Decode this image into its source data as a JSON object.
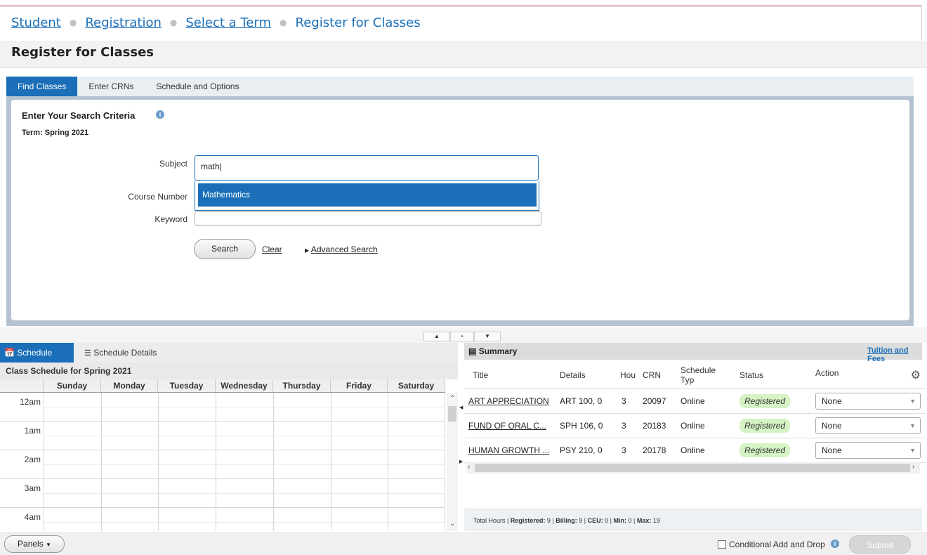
{
  "breadcrumb": {
    "items": [
      "Student",
      "Registration",
      "Select a Term"
    ],
    "current": "Register for Classes"
  },
  "page_title": "Register for Classes",
  "search_tabs": [
    "Find Classes",
    "Enter CRNs",
    "Schedule and Options"
  ],
  "search": {
    "title": "Enter Your Search Criteria",
    "term": "Term: Spring 2021",
    "subject_label": "Subject",
    "subject_value": "math",
    "subject_suggestion": "Mathematics",
    "course_number_label": "Course Number",
    "keyword_label": "Keyword",
    "search_button": "Search",
    "clear_link": "Clear",
    "advanced_link": "Advanced Search"
  },
  "schedule": {
    "tab_schedule": "Schedule",
    "tab_details": "Schedule Details",
    "caption": "Class Schedule for Spring 2021",
    "days": [
      "Sunday",
      "Monday",
      "Tuesday",
      "Wednesday",
      "Thursday",
      "Friday",
      "Saturday"
    ],
    "hours": [
      "12am",
      "1am",
      "2am",
      "3am",
      "4am"
    ]
  },
  "summary": {
    "title": "Summary",
    "tuition_link": "Tuition and Fees",
    "columns": [
      "Title",
      "Details",
      "Hou",
      "CRN",
      "Schedule Typ",
      "Status",
      "Action"
    ],
    "rows": [
      {
        "title": "ART APPRECIATION",
        "details": "ART 100, 0",
        "hours": "3",
        "crn": "20097",
        "type": "Online",
        "status": "Registered",
        "action": "None"
      },
      {
        "title": "FUND OF ORAL C...",
        "details": "SPH 106, 0",
        "hours": "3",
        "crn": "20183",
        "type": "Online",
        "status": "Registered",
        "action": "None"
      },
      {
        "title": "HUMAN GROWTH ...",
        "details": "PSY 210, 0",
        "hours": "3",
        "crn": "20178",
        "type": "Online",
        "status": "Registered",
        "action": "None"
      }
    ],
    "totals": {
      "prefix": "Total Hours | ",
      "registered_label": "Registered:",
      "registered": "9",
      "billing_label": "Billing:",
      "billing": "9",
      "ceu_label": "CEU:",
      "ceu": "0",
      "min_label": "Min:",
      "min": "0",
      "max_label": "Max:",
      "max": "19"
    }
  },
  "footer": {
    "panels_button": "Panels",
    "conditional_label": "Conditional Add and Drop",
    "submit_button": "Submit"
  },
  "colors": {
    "accent": "#1a6fb8",
    "registered_badge": "#d5f3c4",
    "top_rule": "#9b2a36"
  }
}
